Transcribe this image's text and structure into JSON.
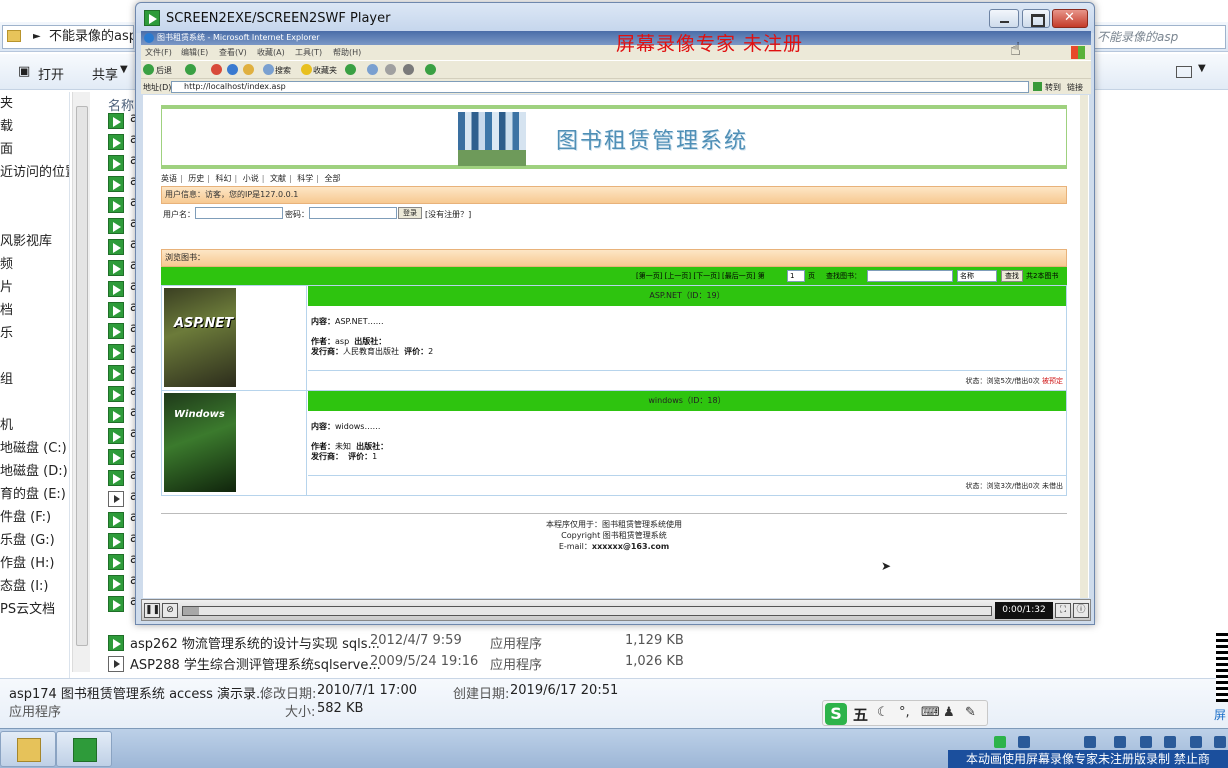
{
  "explorer": {
    "address": "不能录像的asp",
    "search_placeholder": "不能录像的asp",
    "toolbar": {
      "open": "打开",
      "share": "共享"
    },
    "nav_items": [
      "夹",
      "载",
      "面",
      "近访问的位置",
      "",
      "",
      "风影视库",
      "频",
      "片",
      "档",
      "乐",
      "",
      "组",
      "",
      "机",
      "地磁盘 (C:)",
      "地磁盘 (D:)",
      "育的盘 (E:)",
      "件盘 (F:)",
      "乐盘 (G:)",
      "作盘 (H:)",
      "态盘 (I:)",
      "PS云文档"
    ],
    "column_header": "名称",
    "file_rows_hidden_prefix": "a",
    "visible_rows": [
      {
        "name": "asp262 物流管理系统的设计与实现 sqls...",
        "date": "2012/4/7 9:59",
        "type": "应用程序",
        "size": "1,129 KB",
        "icon": "green"
      },
      {
        "name": "ASP288 学生综合测评管理系统sqlserve...",
        "date": "2009/5/24 19:16",
        "type": "应用程序",
        "size": "1,026 KB",
        "icon": "play"
      }
    ],
    "details": {
      "name": "asp174 图书租赁管理系统 access 演示录...",
      "type": "应用程序",
      "modified_label": "修改日期:",
      "modified": "2010/7/1 17:00",
      "created_label": "创建日期:",
      "created": "2019/6/17 20:51",
      "size_label": "大小:",
      "size": "582 KB"
    }
  },
  "player": {
    "title": "SCREEN2EXE/SCREEN2SWF Player",
    "unregistered": "屏幕录像专家  未注册",
    "time": "0:00/1:32",
    "progress": 0.02
  },
  "ie": {
    "title": "图书租赁系统 - Microsoft Internet Explorer",
    "menu": [
      "文件(F)",
      "编辑(E)",
      "查看(V)",
      "收藏(A)",
      "工具(T)",
      "帮助(H)"
    ],
    "tool": {
      "back": "后退",
      "search": "搜索",
      "favorites": "收藏夹"
    },
    "address_label": "地址(D)",
    "address": "http://localhost/index.asp",
    "go": "转到",
    "links": "链接"
  },
  "site": {
    "title": "图书租赁管理系统",
    "categories": [
      "英语",
      "历史",
      "科幻",
      "小说",
      "文献",
      "科学",
      "全部"
    ],
    "user_info": "用户信息：访客，您的IP是127.0.0.1",
    "login": {
      "username_label": "用户名：",
      "password_label": "密码：",
      "button": "登录",
      "register": "[没有注册？]"
    },
    "browse_label": "浏览图书：",
    "pager": {
      "nav": "[第一页] [上一页] [下一页] [最后一页] 第",
      "page": "1",
      "page_suffix": "页",
      "search_label": "查找图书：",
      "field": "名称",
      "search_button": "查找",
      "total": "共2本图书"
    },
    "books": [
      {
        "title": "ASP.NET（ID：19）",
        "cover_text": "ASP.NET",
        "content_label": "内容：",
        "content": "ASP.NET……",
        "author_label": "作者：",
        "author": "asp",
        "publisher_label": "出版社：",
        "publisher": "",
        "issuer_label": "发行商：",
        "issuer": "人民教育出版社",
        "rating_label": "评价：",
        "rating": "2",
        "status": "状态：浏览5次/借出0次",
        "status_flag": "被预定"
      },
      {
        "title": "windows（ID：18）",
        "cover_text": "Windows",
        "content_label": "内容：",
        "content": "widows……",
        "author_label": "作者：",
        "author": "未知",
        "publisher_label": "出版社：",
        "publisher": "",
        "issuer_label": "发行商：",
        "issuer": "",
        "rating_label": "评价：",
        "rating": "1",
        "status": "状态：浏览3次/借出0次",
        "status_flag": "未借出"
      }
    ],
    "footer": {
      "line1": "本程序仅用于：图书租赁管理系统使用",
      "line2": "Copyright 图书租赁管理系统",
      "line3_label": "E-mail：",
      "email": "xxxxxx@163.com"
    }
  },
  "ime": {
    "logo": "S",
    "mode": "五"
  },
  "taskbar": {
    "banner": "本动画使用屏幕录像专家未注册版录制  禁止商",
    "qr_text": "屏"
  }
}
